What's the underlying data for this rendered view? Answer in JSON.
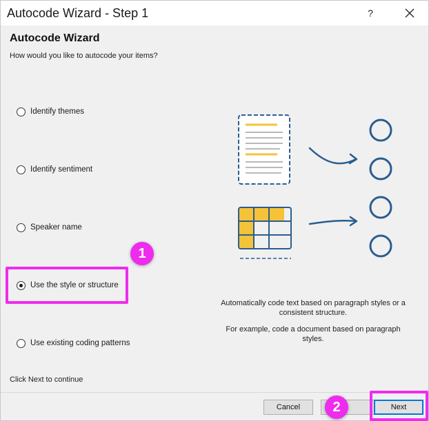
{
  "window": {
    "title": "Autocode Wizard - Step 1",
    "help_label": "?",
    "close_label": "✕"
  },
  "header": {
    "heading": "Autocode Wizard",
    "question": "How would you like to autocode your items?"
  },
  "options": [
    {
      "label": "Identify themes",
      "selected": false
    },
    {
      "label": "Identify sentiment",
      "selected": false
    },
    {
      "label": "Speaker name",
      "selected": false
    },
    {
      "label": "Use the style or structure",
      "selected": true
    },
    {
      "label": "Use existing coding patterns",
      "selected": false
    }
  ],
  "description": {
    "main": "Automatically code text based on paragraph styles or a consistent structure.",
    "example": "For example, code a document based on paragraph styles."
  },
  "footer": {
    "hint": "Click Next to continue",
    "cancel_label": "Cancel",
    "next_label": "Next"
  },
  "callouts": {
    "first": "1",
    "second": "2"
  },
  "colors": {
    "highlight": "#ee2cee",
    "illustration_blue": "#2b5d8f",
    "illustration_yellow": "#f5c338"
  },
  "icons": {
    "document": "document-icon",
    "table": "table-icon",
    "arrow": "arrow-icon",
    "node": "circle-node-icon"
  }
}
